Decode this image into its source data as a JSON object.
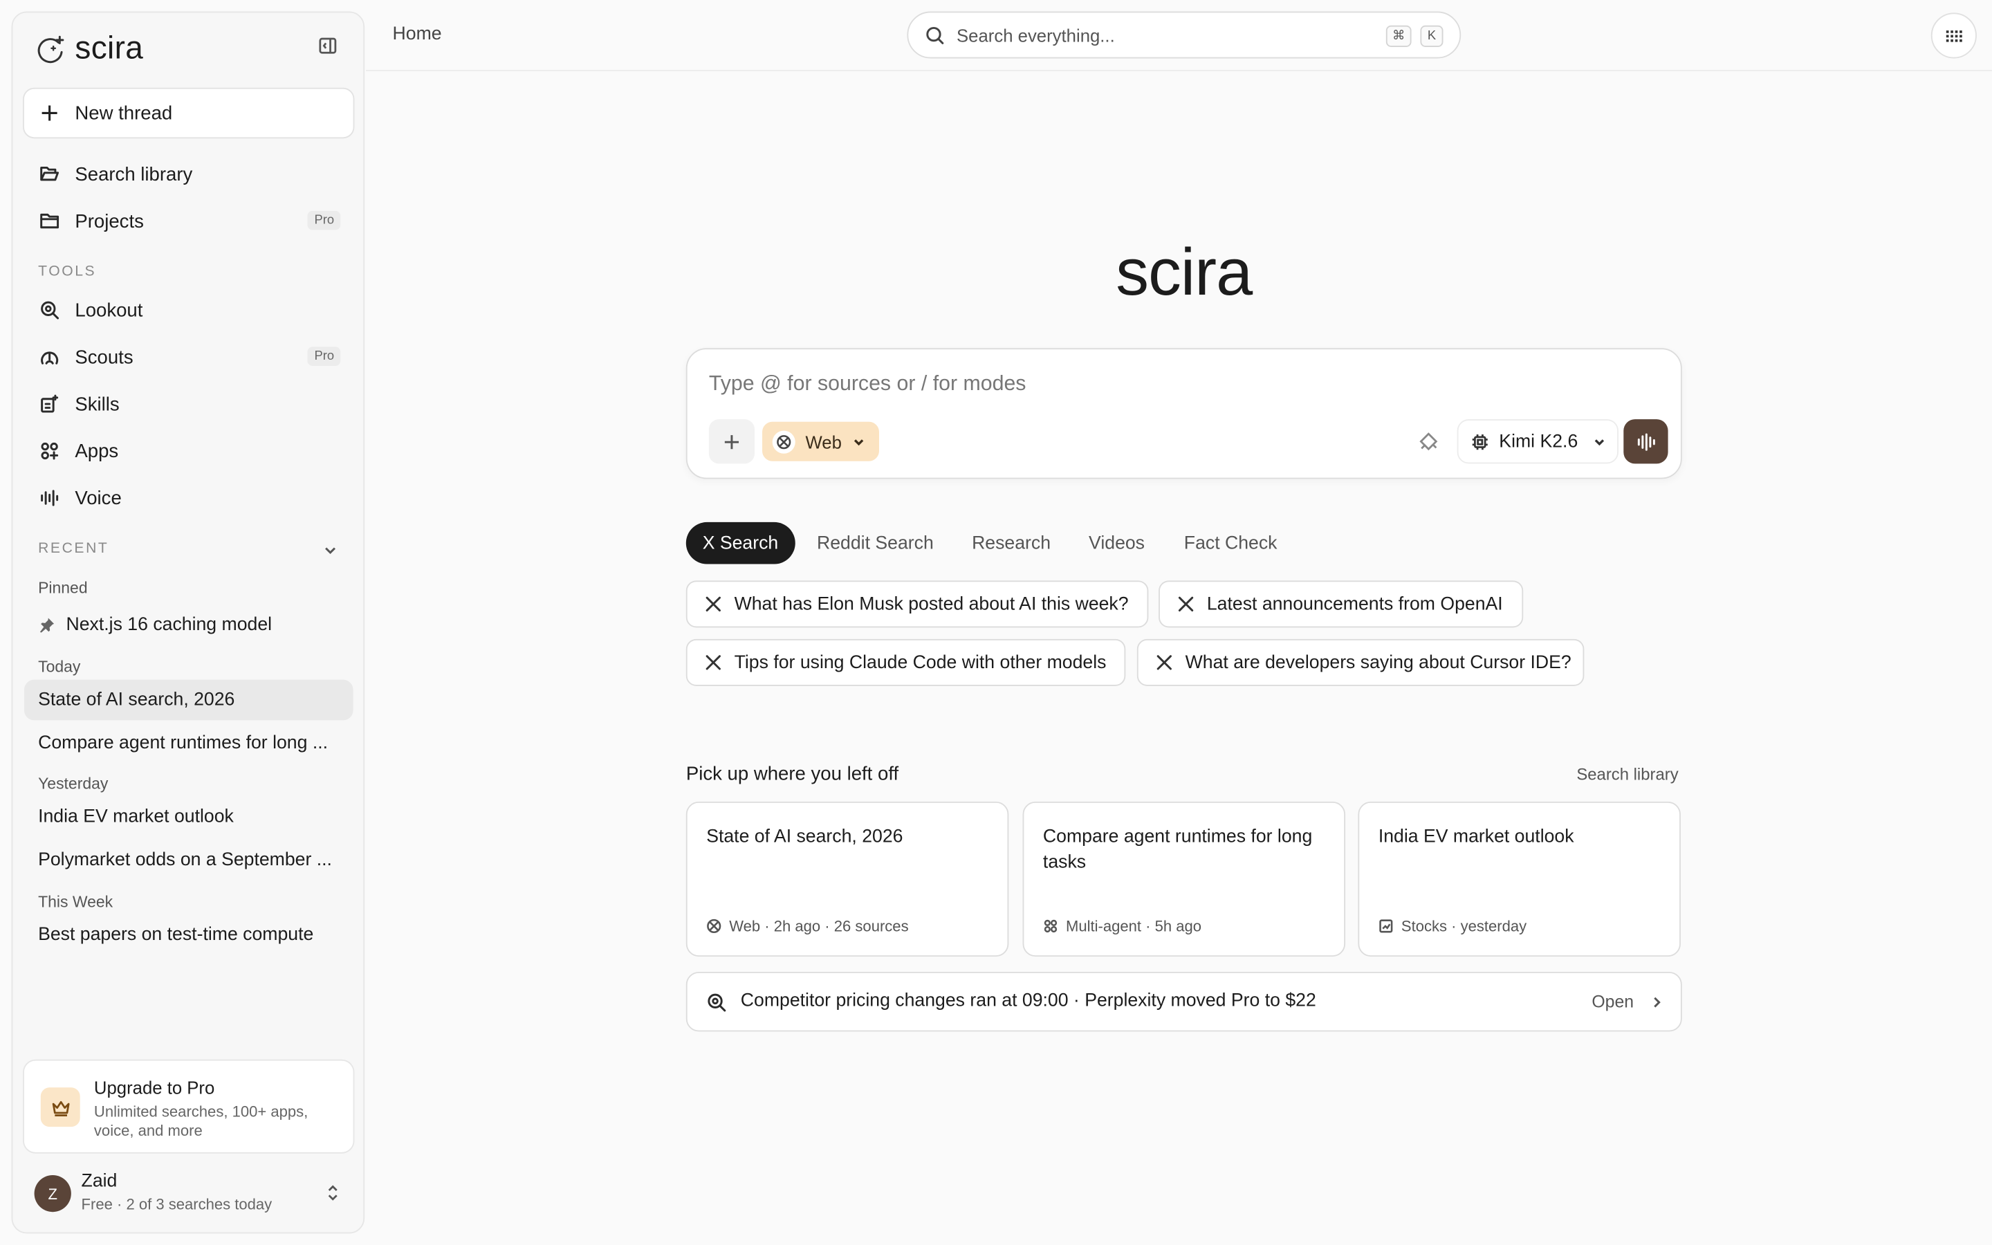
{
  "app": {
    "name": "scira"
  },
  "sidebar": {
    "new_thread": "New thread",
    "nav": [
      {
        "label": "Search library",
        "icon": "folder-open-icon"
      },
      {
        "label": "Projects",
        "icon": "folder-icon",
        "badge": "Pro"
      }
    ],
    "tools_label": "TOOLS",
    "tools": [
      {
        "label": "Lookout",
        "icon": "search-zoom-icon"
      },
      {
        "label": "Scouts",
        "icon": "radar-icon",
        "badge": "Pro"
      },
      {
        "label": "Skills",
        "icon": "skills-icon"
      },
      {
        "label": "Apps",
        "icon": "apps-icon"
      },
      {
        "label": "Voice",
        "icon": "waveform-icon"
      }
    ],
    "recent_label": "RECENT",
    "recent": {
      "pinned_label": "Pinned",
      "pinned": [
        "Next.js 16 caching model"
      ],
      "today_label": "Today",
      "today": [
        "State of AI search, 2026",
        "Compare agent runtimes for long ..."
      ],
      "yesterday_label": "Yesterday",
      "yesterday": [
        "India EV market outlook",
        "Polymarket odds on a September ..."
      ],
      "this_week_label": "This Week",
      "this_week": [
        "Best papers on test-time compute"
      ]
    },
    "upgrade": {
      "title": "Upgrade to Pro",
      "description": "Unlimited searches, 100+ apps, voice, and more"
    },
    "user": {
      "initial": "Z",
      "name": "Zaid",
      "plan": "Free · 2 of 3 searches today"
    }
  },
  "topbar": {
    "breadcrumb": "Home",
    "search_placeholder": "Search everything...",
    "shortcut_keys": [
      "⌘",
      "K"
    ]
  },
  "main": {
    "hero": "scira",
    "composer": {
      "placeholder": "Type @ for sources or / for modes",
      "source": "Web",
      "model": "Kimi K2.6"
    },
    "tabs": [
      "X Search",
      "Reddit Search",
      "Research",
      "Videos",
      "Fact Check"
    ],
    "active_tab": "X Search",
    "suggestions": [
      "What has Elon Musk posted about AI this week?",
      "Latest announcements from OpenAI",
      "Tips for using Claude Code with other models",
      "What are developers saying about Cursor IDE?"
    ],
    "continue": {
      "title": "Pick up where you left off",
      "link": "Search library",
      "cards": [
        {
          "title": "State of AI search, 2026",
          "meta": "Web · 2h ago · 26 sources",
          "icon": "globe-icon"
        },
        {
          "title": "Compare agent runtimes for long tasks",
          "meta": "Multi-agent · 5h ago",
          "icon": "multi-agent-icon"
        },
        {
          "title": "India EV market outlook",
          "meta": "Stocks · yesterday",
          "icon": "chart-icon"
        }
      ]
    },
    "lookout_banner": {
      "text": "Competitor pricing changes ran at 09:00 · Perplexity moved Pro to $22",
      "action": "Open"
    }
  },
  "colors": {
    "accent_brown": "#5a4438",
    "chip_peach": "#fbe3c1",
    "background": "#fafafa"
  }
}
